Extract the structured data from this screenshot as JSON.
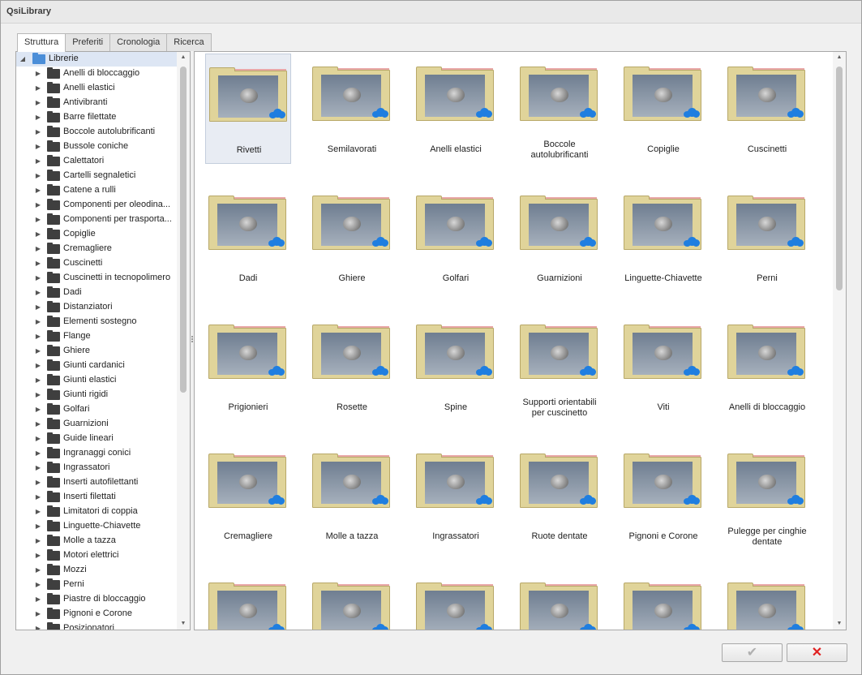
{
  "window": {
    "title": "QsiLibrary"
  },
  "tabs": [
    "Struttura",
    "Preferiti",
    "Cronologia",
    "Ricerca"
  ],
  "tree": {
    "root": "Librerie",
    "items": [
      "Anelli di bloccaggio",
      "Anelli elastici",
      "Antivibranti",
      "Barre filettate",
      "Boccole autolubrificanti",
      "Bussole coniche",
      "Calettatori",
      "Cartelli segnaletici",
      "Catene a rulli",
      "Componenti per oleodina...",
      "Componenti per trasporta...",
      "Copiglie",
      "Cremagliere",
      "Cuscinetti",
      "Cuscinetti in tecnopolimero",
      "Dadi",
      "Distanziatori",
      "Elementi sostegno",
      "Flange",
      "Ghiere",
      "Giunti cardanici",
      "Giunti elastici",
      "Giunti rigidi",
      "Golfari",
      "Guarnizioni",
      "Guide lineari",
      "Ingranaggi conici",
      "Ingrassatori",
      "Inserti autofilettanti",
      "Inserti filettati",
      "Limitatori di coppia",
      "Linguette-Chiavette",
      "Molle a tazza",
      "Motori elettrici",
      "Mozzi",
      "Perni",
      "Piastre di bloccaggio",
      "Pignoni e Corone",
      "Posizionatori"
    ]
  },
  "grid": {
    "items": [
      [
        "Rivetti"
      ],
      [
        "Semilavorati"
      ],
      [
        "Anelli elastici"
      ],
      [
        "Boccole",
        "autolubrificanti"
      ],
      [
        "Copiglie"
      ],
      [
        "Cuscinetti"
      ],
      [
        "Dadi"
      ],
      [
        "Ghiere"
      ],
      [
        "Golfari"
      ],
      [
        "Guarnizioni"
      ],
      [
        "Linguette-Chiavette"
      ],
      [
        "Perni"
      ],
      [
        "Prigionieri"
      ],
      [
        "Rosette"
      ],
      [
        "Spine"
      ],
      [
        "Supporti orientabili",
        "per cuscinetto"
      ],
      [
        "Viti"
      ],
      [
        "Anelli di bloccaggio"
      ],
      [
        "Cremagliere"
      ],
      [
        "Molle a tazza"
      ],
      [
        "Ingrassatori"
      ],
      [
        "Ruote dentate"
      ],
      [
        "Pignoni e Corone"
      ],
      [
        "Pulegge per cinghie",
        "dentate"
      ],
      [
        ""
      ],
      [
        ""
      ],
      [
        ""
      ],
      [
        ""
      ],
      [
        ""
      ],
      [
        ""
      ]
    ]
  },
  "buttons": {
    "ok_icon": "check-icon",
    "cancel_icon": "close-icon"
  },
  "colors": {
    "cloud": "#1f7ee0",
    "cancel": "#e02020",
    "folder": "#e0d49a",
    "selection": "#dde6f4"
  }
}
